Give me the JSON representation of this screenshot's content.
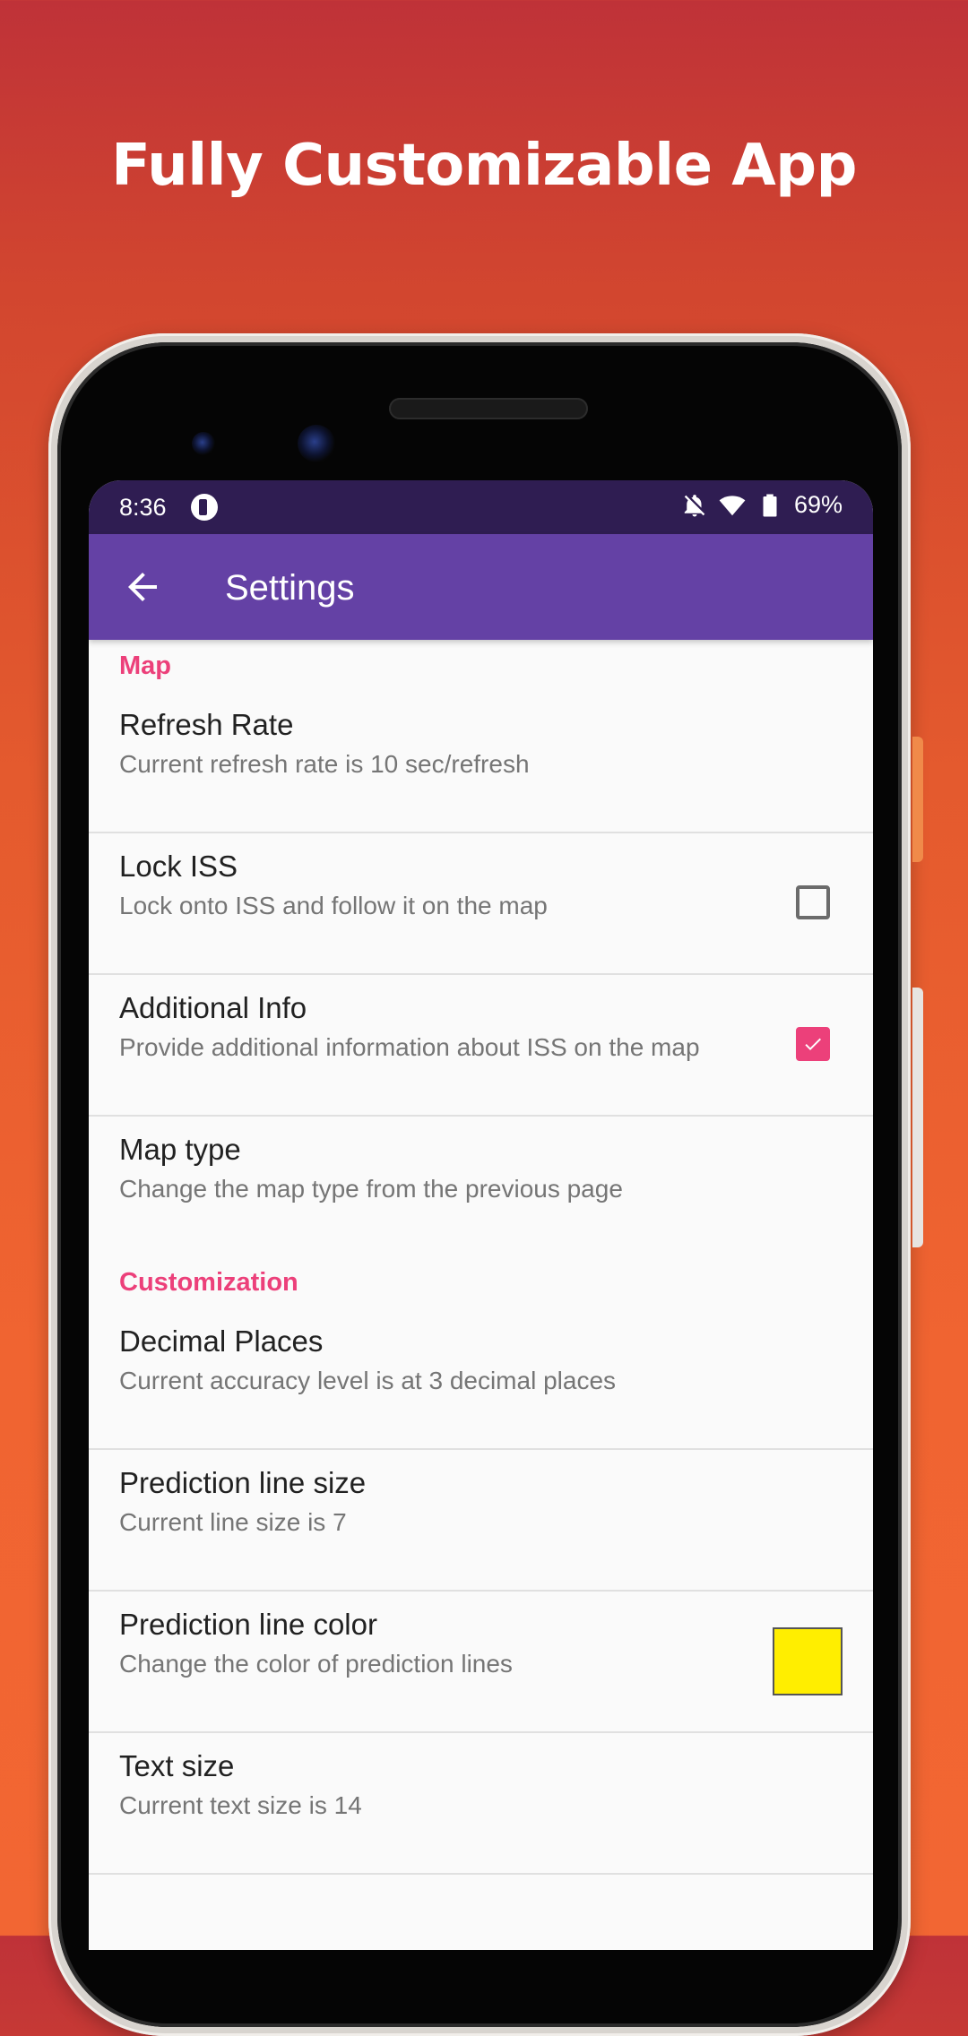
{
  "headline": "Fully Customizable App",
  "status_bar": {
    "time": "8:36",
    "battery": "69%",
    "icons": [
      "app-notification-icon",
      "bell-off-icon",
      "wifi-icon",
      "battery-icon"
    ]
  },
  "app_bar": {
    "title": "Settings",
    "back_icon": "arrow-left-icon",
    "color": "#6441a5"
  },
  "colors": {
    "accent": "#ec407a",
    "status_bar": "#2f1d52",
    "prediction_line": "#ffee00"
  },
  "sections": [
    {
      "category": "Map",
      "items": [
        {
          "title": "Refresh Rate",
          "summary": "Current refresh rate is 10 sec/refresh"
        },
        {
          "title": "Lock ISS",
          "summary": "Lock onto ISS and follow it on the map",
          "checked": false
        },
        {
          "title": "Additional Info",
          "summary": "Provide additional information about ISS on the map",
          "checked": true
        },
        {
          "title": "Map type",
          "summary": "Change the map type from the previous page"
        }
      ]
    },
    {
      "category": "Customization",
      "items": [
        {
          "title": "Decimal Places",
          "summary": "Current accuracy level is at 3 decimal places"
        },
        {
          "title": "Prediction line size",
          "summary": "Current line size is 7"
        },
        {
          "title": "Prediction line color",
          "summary": "Change the color of prediction lines"
        },
        {
          "title": "Text size",
          "summary": "Current text size is 14"
        }
      ]
    }
  ]
}
